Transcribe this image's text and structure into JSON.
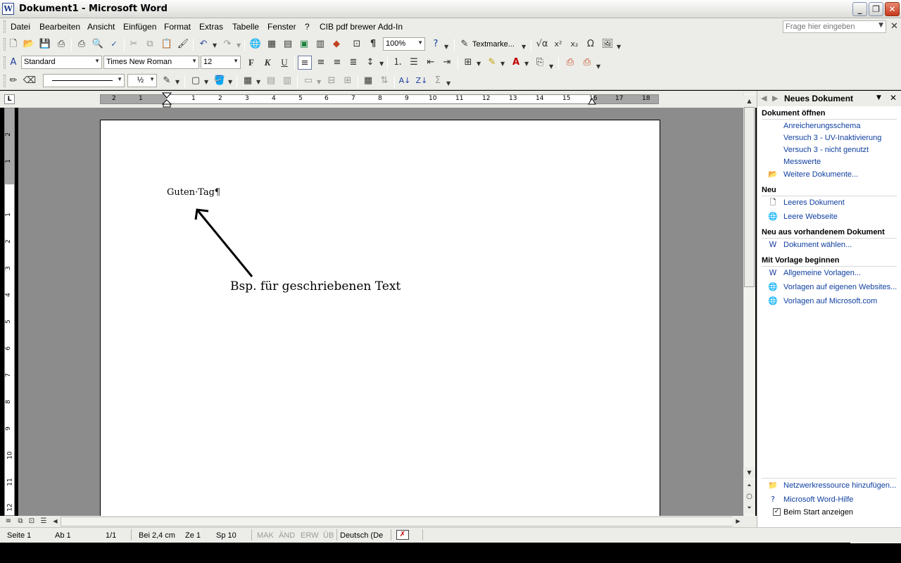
{
  "window": {
    "title": "Dokument1 - Microsoft Word"
  },
  "menubar": {
    "items": [
      "Datei",
      "Bearbeiten",
      "Ansicht",
      "Einfügen",
      "Format",
      "Extras",
      "Tabelle",
      "Fenster",
      "?",
      "CIB pdf brewer Add-In"
    ],
    "help_placeholder": "Frage hier eingeben"
  },
  "toolbar": {
    "zoom": "100%",
    "textmarker_label": "Textmarke...",
    "style": "Standard",
    "font": "Times New Roman",
    "font_size": "12",
    "bold_label": "F",
    "italic_label": "K",
    "underline_label": "U",
    "line_weight": "½"
  },
  "ruler": {
    "h_numbers": [
      "2",
      "1",
      "1",
      "2",
      "3",
      "4",
      "5",
      "6",
      "7",
      "8",
      "9",
      "10",
      "11",
      "12",
      "13",
      "14",
      "15",
      "16",
      "17",
      "18"
    ],
    "v_numbers": [
      "2",
      "1",
      "1",
      "2",
      "3",
      "4",
      "5",
      "6",
      "7",
      "8",
      "9",
      "10",
      "11",
      "12"
    ]
  },
  "document": {
    "text": "Guten·Tag¶",
    "caption": "Bsp. für geschriebenen Text"
  },
  "taskpane": {
    "title": "Neues Dokument",
    "open_heading": "Dokument öffnen",
    "recent": [
      "Anreicherungsschema",
      "Versuch 3 - UV-Inaktivierung",
      "Versuch 3 - nicht genutzt",
      "Messwerte"
    ],
    "more_docs": "Weitere Dokumente...",
    "new_heading": "Neu",
    "new_items": [
      "Leeres Dokument",
      "Leere Webseite"
    ],
    "existing_heading": "Neu aus vorhandenem Dokument",
    "existing_item": "Dokument wählen...",
    "template_heading": "Mit Vorlage beginnen",
    "template_items": [
      "Allgemeine Vorlagen...",
      "Vorlagen auf eigenen Websites...",
      "Vorlagen auf Microsoft.com"
    ],
    "footer_items": [
      "Netzwerkressource hinzufügen...",
      "Microsoft Word-Hilfe",
      "Beim Start anzeigen"
    ]
  },
  "statusbar": {
    "page": "Seite  1",
    "section": "Ab  1",
    "pages": "1/1",
    "position": "Bei  2,4 cm",
    "line": "Ze  1",
    "column": "Sp  10",
    "mak": "MAK",
    "aend": "ÄND",
    "erw": "ERW",
    "ueb": "ÜB",
    "language": "Deutsch (De"
  },
  "colors": {
    "link": "#1040a0",
    "workspace": "#8c8c8c",
    "chrome": "#ecece8"
  }
}
